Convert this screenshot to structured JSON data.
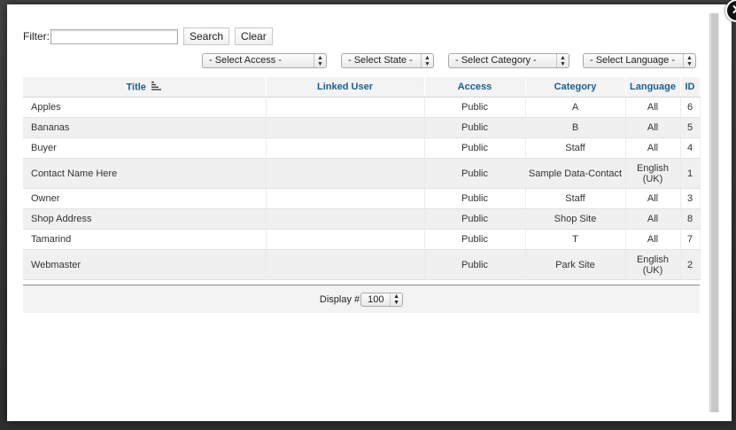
{
  "filter": {
    "label": "Filter:",
    "value": "",
    "placeholder": "",
    "search_label": "Search",
    "clear_label": "Clear"
  },
  "selects": {
    "access": "- Select Access -",
    "state": "- Select State -",
    "category": "- Select Category -",
    "language": "- Select Language -"
  },
  "close_glyph": "✕",
  "table": {
    "headers": {
      "title": "Title",
      "linked_user": "Linked User",
      "access": "Access",
      "category": "Category",
      "language": "Language",
      "id": "ID"
    },
    "rows": [
      {
        "title": "Apples",
        "linked_user": "",
        "access": "Public",
        "category": "A",
        "language": "All",
        "id": "6"
      },
      {
        "title": "Bananas",
        "linked_user": "",
        "access": "Public",
        "category": "B",
        "language": "All",
        "id": "5"
      },
      {
        "title": "Buyer",
        "linked_user": "",
        "access": "Public",
        "category": "Staff",
        "language": "All",
        "id": "4"
      },
      {
        "title": "Contact Name Here",
        "linked_user": "",
        "access": "Public",
        "category": "Sample Data-Contact",
        "language": "English (UK)",
        "id": "1"
      },
      {
        "title": "Owner",
        "linked_user": "",
        "access": "Public",
        "category": "Staff",
        "language": "All",
        "id": "3"
      },
      {
        "title": "Shop Address",
        "linked_user": "",
        "access": "Public",
        "category": "Shop Site",
        "language": "All",
        "id": "8"
      },
      {
        "title": "Tamarind",
        "linked_user": "",
        "access": "Public",
        "category": "T",
        "language": "All",
        "id": "7"
      },
      {
        "title": "Webmaster",
        "linked_user": "",
        "access": "Public",
        "category": "Park Site",
        "language": "English (UK)",
        "id": "2"
      }
    ]
  },
  "footer": {
    "display_label": "Display #",
    "limit_value": "100"
  },
  "colors": {
    "header_link": "#1a5f92",
    "row_alt": "#f0f0f0"
  },
  "icons": {
    "sort": "sort-ascending-icon",
    "close": "close-icon",
    "select_arrows": "up-down-arrows-icon"
  }
}
